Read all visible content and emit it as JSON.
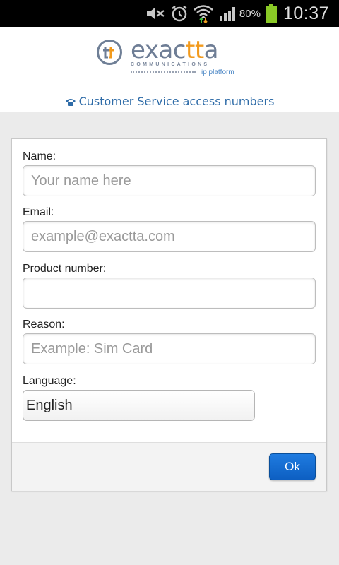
{
  "status_bar": {
    "battery_percent": "80%",
    "time": "10:37",
    "icons": [
      "mute-icon",
      "alarm-icon",
      "wifi-icon",
      "signal-icon",
      "battery-icon"
    ]
  },
  "header": {
    "logo_word_start": "exac",
    "logo_word_accent": "tt",
    "logo_word_end": "a",
    "logo_subtitle": "COMMUNICATIONS",
    "logo_tagline": "ip platform",
    "cs_link": "Customer Service access numbers"
  },
  "form": {
    "fields": {
      "name": {
        "label": "Name:",
        "value": "",
        "placeholder": "Your name here"
      },
      "email": {
        "label": "Email:",
        "value": "",
        "placeholder": "example@exactta.com"
      },
      "product": {
        "label": "Product number:",
        "value": "",
        "placeholder": ""
      },
      "reason": {
        "label": "Reason:",
        "value": "",
        "placeholder": "Example: Sim Card"
      }
    },
    "language": {
      "label": "Language:",
      "selected": "English"
    },
    "ok_label": "Ok"
  },
  "colors": {
    "accent_orange": "#f29a1c",
    "logo_gray": "#6e7d95",
    "link_blue": "#2f6ca8",
    "button_blue": "#1469d1"
  }
}
